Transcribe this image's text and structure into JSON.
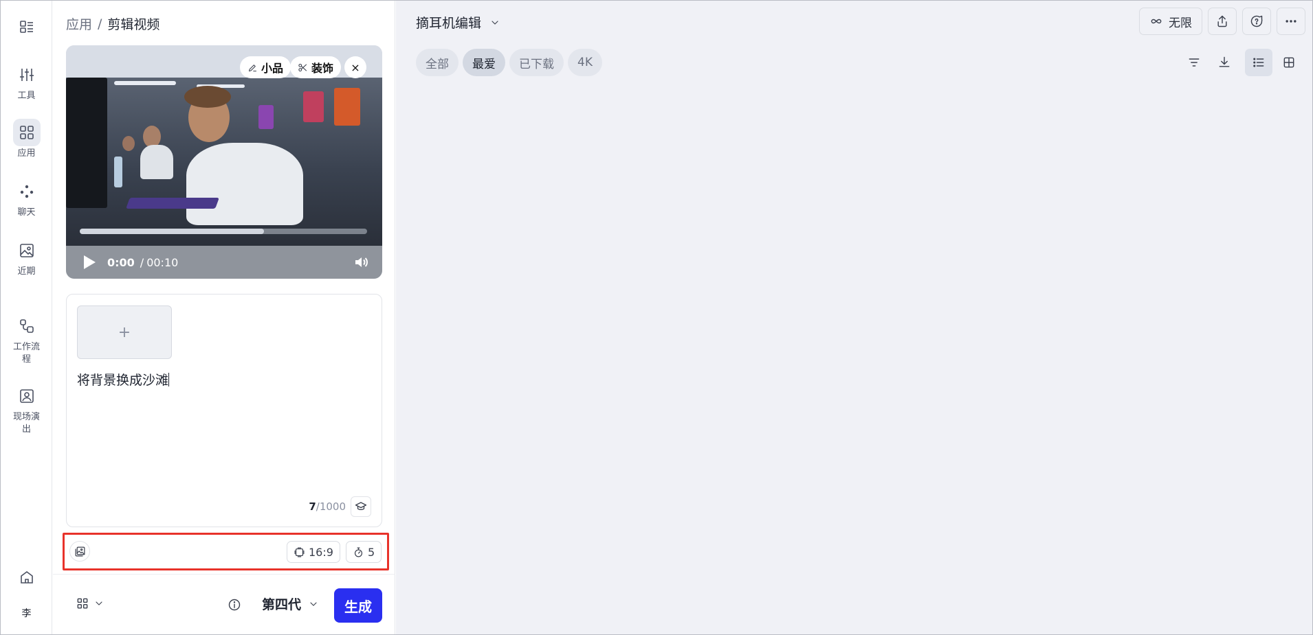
{
  "rail": {
    "items": [
      {
        "label": "",
        "icon": "menu-icon"
      },
      {
        "label": "工具",
        "icon": "sliders-icon"
      },
      {
        "label": "应用",
        "icon": "grid-icon",
        "active": true
      },
      {
        "label": "聊天",
        "icon": "dots-icon"
      },
      {
        "label": "近期",
        "icon": "image-icon"
      },
      {
        "label": "工作流程",
        "icon": "workflow-icon"
      },
      {
        "label": "现场演出",
        "icon": "user-frame-icon"
      }
    ],
    "home_icon": "home-icon",
    "avatar_text": "李"
  },
  "breadcrumb": {
    "parent": "应用",
    "separator": "/",
    "current": "剪辑视频"
  },
  "video": {
    "chip_sketch": "小品",
    "chip_decor": "装饰",
    "close_glyph": "×",
    "current_time": "0:00",
    "duration": "00:10",
    "progress_fraction": 0.64
  },
  "prompt": {
    "add_glyph": "+",
    "text": "将背景换成沙滩",
    "count": "7",
    "max": "/1000"
  },
  "options": {
    "aspect_ratio": "16:9",
    "duration": "5"
  },
  "bottom": {
    "model": "第四代",
    "generate_label": "生成"
  },
  "main": {
    "project_title": "摘耳机编辑",
    "unlimited_label": "无限",
    "filters": [
      "全部",
      "最爱",
      "已下载",
      "4K"
    ],
    "active_filter": "最爱"
  },
  "colors": {
    "accent": "#2a2ff0",
    "highlight_border": "#e8322a",
    "main_bg": "#f0f1f6"
  }
}
